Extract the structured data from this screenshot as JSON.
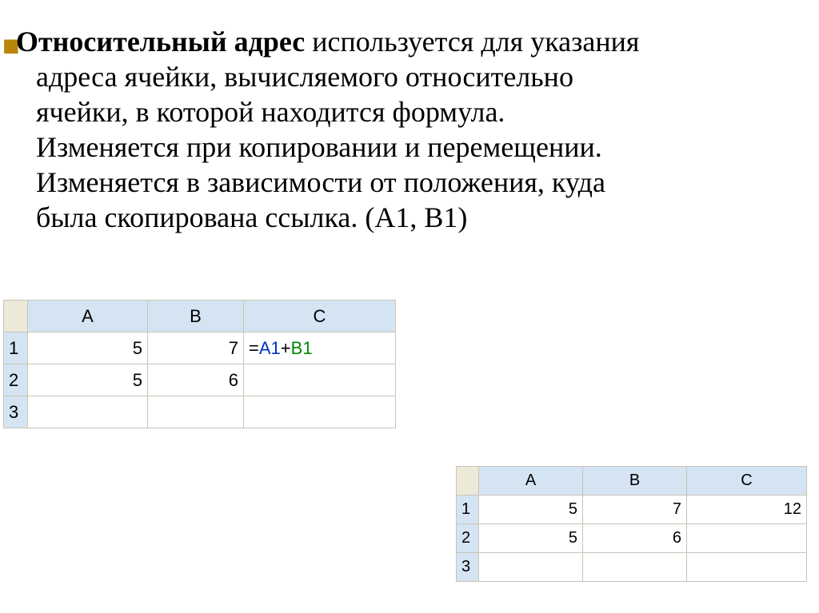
{
  "text": {
    "title_bold": "Относительный адрес",
    "title_rest": " используется для указания",
    "line2": "адреса ячейки, вычисляемого относительно",
    "line3": "ячейки, в которой находится формула.",
    "line4": "Изменяется при копировании и перемещении.",
    "line5": "Изменяется в зависимости от положения, куда",
    "line6": "была скопирована ссылка. (А1, В1)"
  },
  "sheet1": {
    "headers": {
      "A": "A",
      "B": "B",
      "C": "C"
    },
    "rows": {
      "r1": {
        "label": "1",
        "A": "5",
        "B": "7",
        "C_eq": "=",
        "C_ref1": "A1",
        "C_plus": "+",
        "C_ref2": "B1"
      },
      "r2": {
        "label": "2",
        "A": "5",
        "B": "6",
        "C": ""
      },
      "r3": {
        "label": "3",
        "A": "",
        "B": "",
        "C": ""
      }
    }
  },
  "sheet2": {
    "headers": {
      "A": "A",
      "B": "B",
      "C": "C"
    },
    "rows": {
      "r1": {
        "label": "1",
        "A": "5",
        "B": "7",
        "C": "12"
      },
      "r2": {
        "label": "2",
        "A": "5",
        "B": "6",
        "C": ""
      },
      "r3": {
        "label": "3",
        "A": "",
        "B": "",
        "C": ""
      }
    }
  }
}
